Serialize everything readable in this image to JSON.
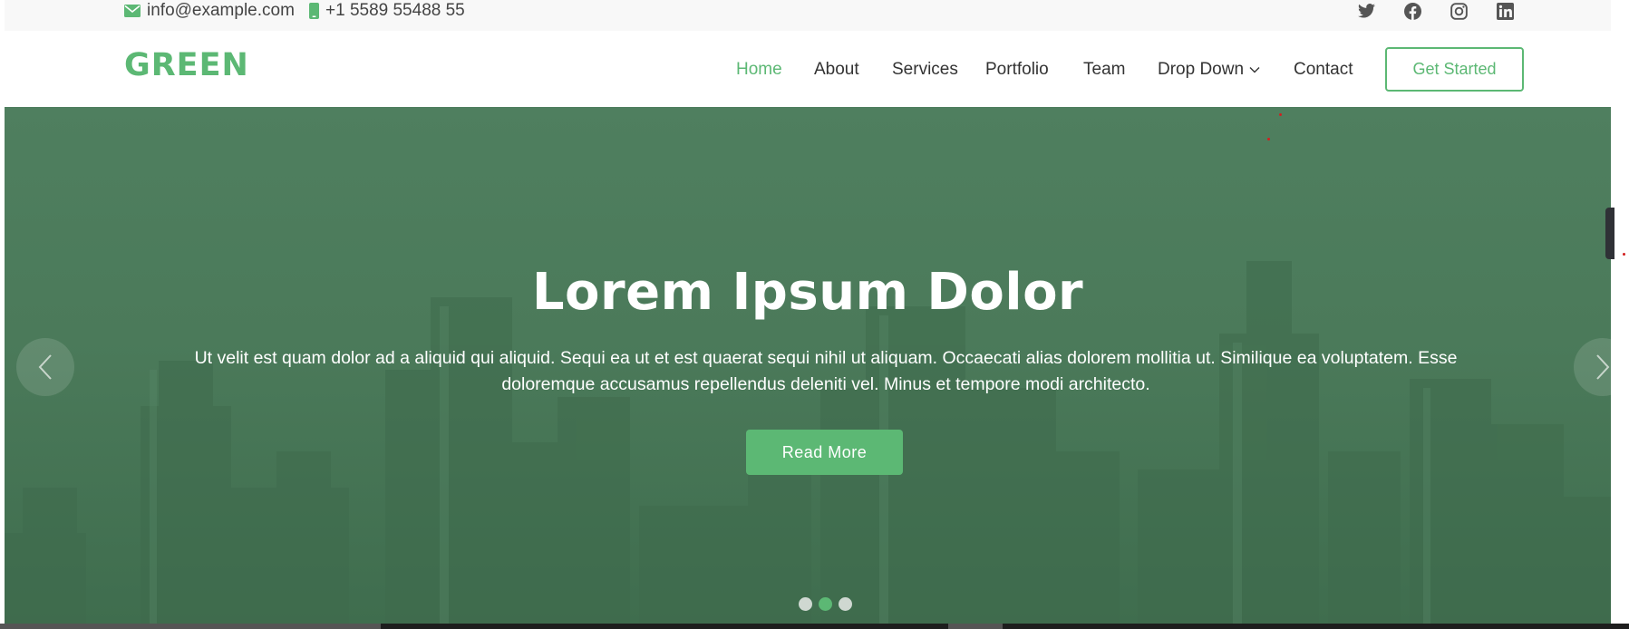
{
  "topbar": {
    "email": "info@example.com",
    "phone": "+1 5589 55488 55",
    "social_icons": [
      "twitter-icon",
      "facebook-icon",
      "instagram-icon",
      "linkedin-icon"
    ]
  },
  "header": {
    "logo": "GREEN",
    "nav": [
      {
        "label": "Home",
        "active": true
      },
      {
        "label": "About"
      },
      {
        "label": "Services"
      },
      {
        "label": "Portfolio"
      },
      {
        "label": "Team"
      },
      {
        "label": "Drop Down",
        "dropdown": true
      },
      {
        "label": "Contact"
      }
    ],
    "cta": "Get Started"
  },
  "hero": {
    "title": "Lorem Ipsum Dolor",
    "text_line1": "Ut velit est quam dolor ad a aliquid qui aliquid. Sequi ea ut et est quaerat sequi nihil ut aliquam. Occaecati alias dolorem mollitia ut. Similique ea voluptatem. Esse",
    "text_line2": "doloremque accusamus repellendus deleniti vel. Minus et tempore modi architecto.",
    "button": "Read More",
    "slides": 3,
    "active_slide": 2
  },
  "colors": {
    "accent": "#5cb874",
    "hero_overlay": "#4b7a5a",
    "topbar_bg": "#f8f8f8"
  }
}
